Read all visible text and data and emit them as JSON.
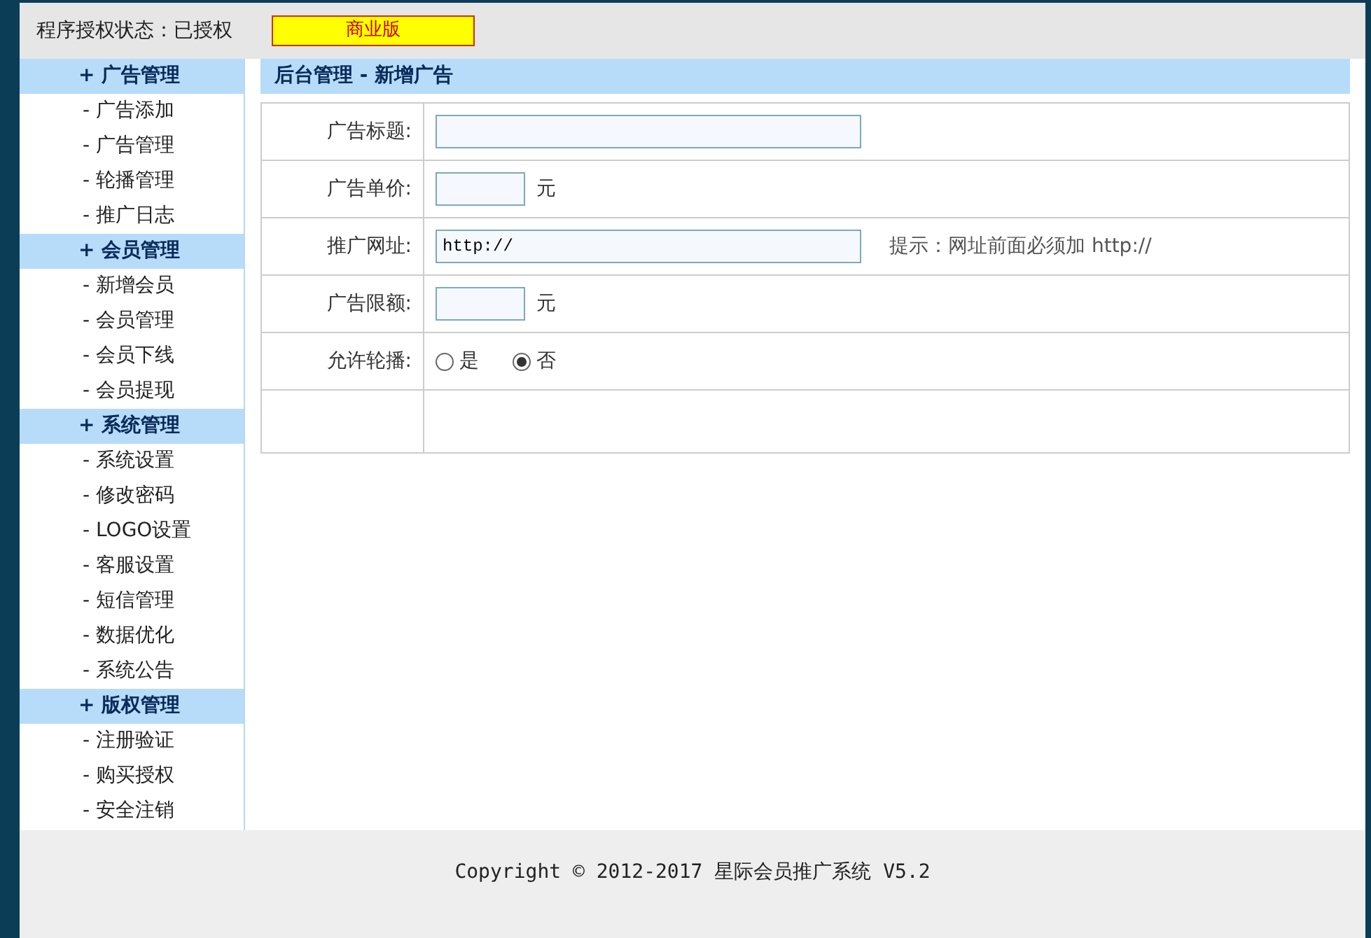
{
  "top_bar": {
    "status": "程序授权状态：已授权",
    "edition": "商业版"
  },
  "sidebar": {
    "groups": [
      {
        "title": "+ 广告管理",
        "items": [
          "- 广告添加",
          "- 广告管理",
          "- 轮播管理",
          "- 推广日志"
        ]
      },
      {
        "title": "+ 会员管理",
        "items": [
          "- 新增会员",
          "- 会员管理",
          "- 会员下线",
          "- 会员提现"
        ]
      },
      {
        "title": "+ 系统管理",
        "items": [
          "- 系统设置",
          "- 修改密码",
          "- LOGO设置",
          "- 客服设置",
          "- 短信管理",
          "- 数据优化",
          "- 系统公告"
        ]
      },
      {
        "title": "+ 版权管理",
        "items": [
          "- 注册验证",
          "- 购买授权",
          "- 安全注销"
        ]
      }
    ]
  },
  "main": {
    "title": "后台管理 - 新增广告",
    "form": [
      {
        "kind": "wide",
        "label": "广告标题:"
      },
      {
        "kind": "short",
        "label": "广告单价:",
        "suffix": "元"
      },
      {
        "kind": "wide",
        "label": "推广网址:",
        "value": "http://",
        "hint": "提示：网址前面必须加 http://"
      },
      {
        "kind": "short",
        "label": "广告限额:",
        "suffix": "元"
      },
      {
        "kind": "radio",
        "label": "允许轮播:",
        "options": [
          {
            "label": "是",
            "selected": false
          },
          {
            "label": "否",
            "selected": true
          }
        ]
      },
      {
        "kind": "blank"
      }
    ]
  },
  "footer": {
    "text": "Copyright © 2012-2017 星际会员推广系统 V5.2"
  }
}
